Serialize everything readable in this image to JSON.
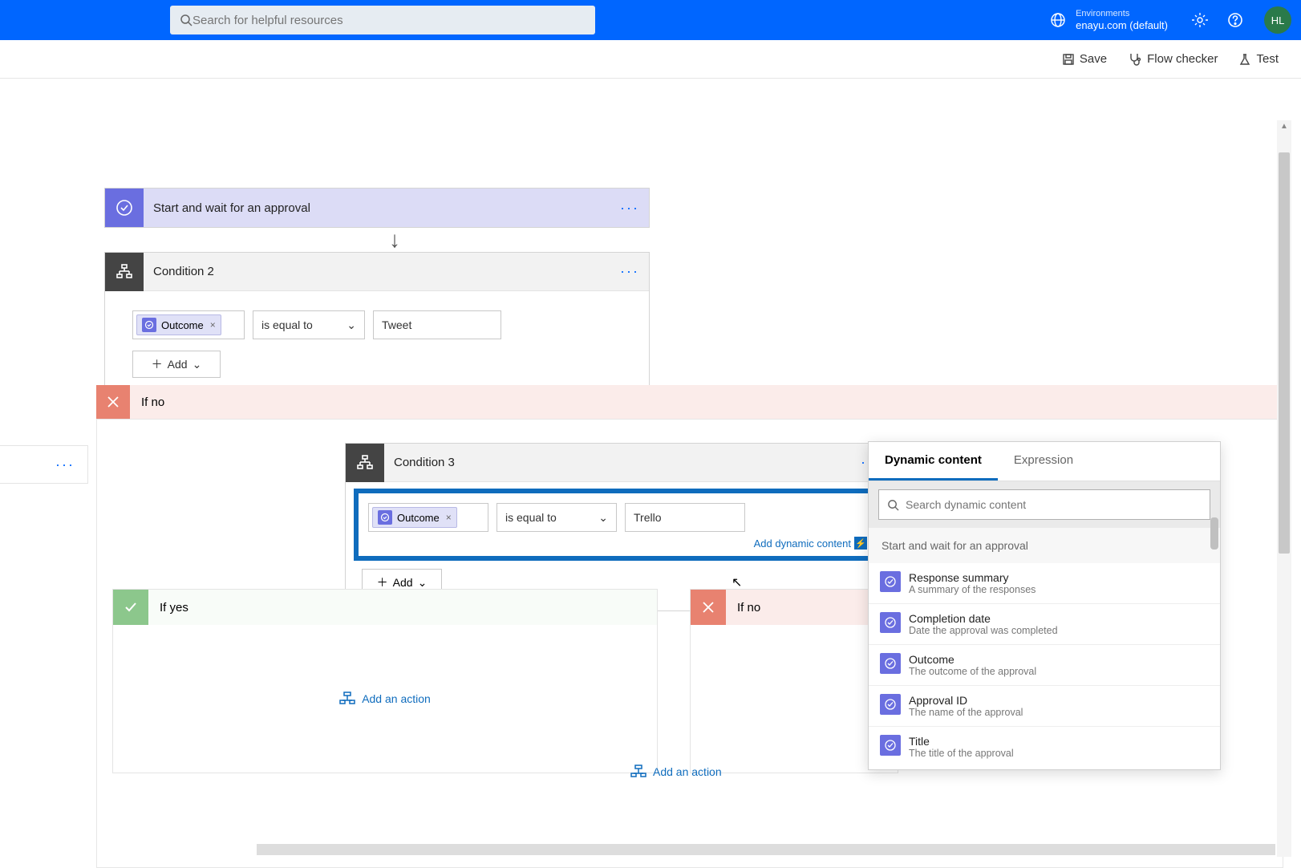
{
  "header": {
    "search_placeholder": "Search for helpful resources",
    "env_label": "Environments",
    "env_name": "enayu.com (default)",
    "avatar": "HL"
  },
  "toolbar": {
    "save": "Save",
    "flow_checker": "Flow checker",
    "test": "Test"
  },
  "approval": {
    "title": "Start and wait for an approval"
  },
  "condition2": {
    "title": "Condition 2",
    "token": "Outcome",
    "operator": "is equal to",
    "value": "Tweet",
    "add": "Add"
  },
  "ifno_big": {
    "title": "If no"
  },
  "condition3": {
    "title": "Condition 3",
    "token": "Outcome",
    "operator": "is equal to",
    "value": "Trello",
    "add_dynamic": "Add dynamic content",
    "add": "Add"
  },
  "branches": {
    "yes": "If yes",
    "no": "If no",
    "add_action": "Add an action"
  },
  "dynamic": {
    "tab_dc": "Dynamic content",
    "tab_ex": "Expression",
    "search_placeholder": "Search dynamic content",
    "section": "Start and wait for an approval",
    "items": [
      {
        "title": "Response summary",
        "desc": "A summary of the responses"
      },
      {
        "title": "Completion date",
        "desc": "Date the approval was completed"
      },
      {
        "title": "Outcome",
        "desc": "The outcome of the approval"
      },
      {
        "title": "Approval ID",
        "desc": "The name of the approval"
      },
      {
        "title": "Title",
        "desc": "The title of the approval"
      }
    ]
  }
}
